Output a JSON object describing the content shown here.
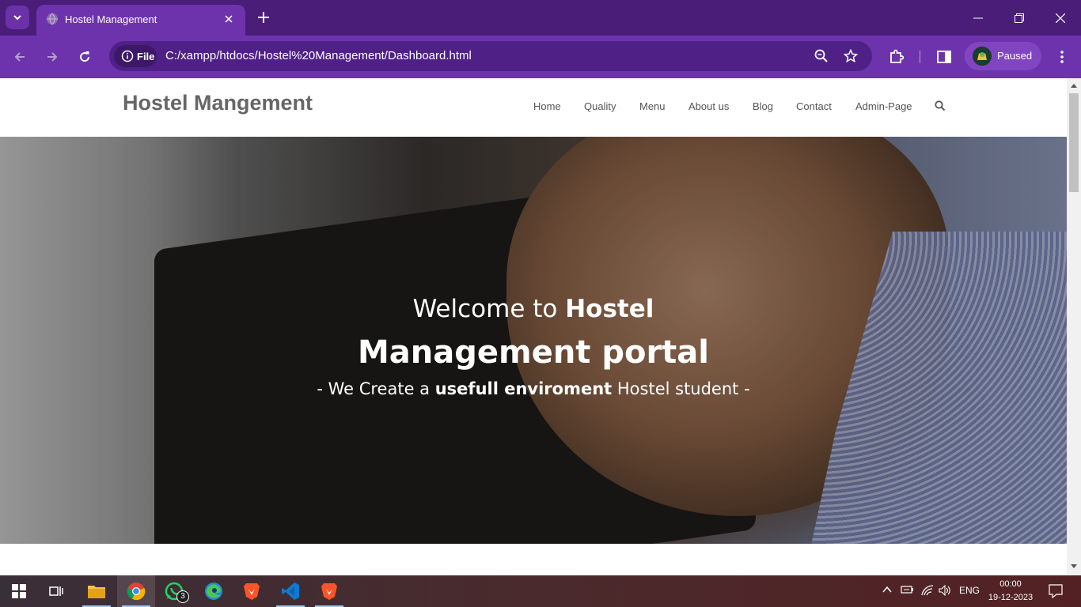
{
  "browser": {
    "tab_title": "Hostel Management",
    "site_info_label": "File",
    "url": "C:/xampp/htdocs/Hostel%20Management/Dashboard.html",
    "profile_label": "Paused"
  },
  "site": {
    "brand": "Hostel Mangement",
    "nav": [
      "Home",
      "Quality",
      "Menu",
      "About us",
      "Blog",
      "Contact",
      "Admin-Page"
    ],
    "hero": {
      "line1_normal": "Welcome to ",
      "line1_bold": "Hostel",
      "line2": "Management portal",
      "line3_pre": "- We Create a ",
      "line3_bold": "usefull enviroment",
      "line3_post": " Hostel student -"
    }
  },
  "taskbar": {
    "whatsapp_badge": "3",
    "language": "ENG",
    "time": "00:00",
    "date": "19-12-2023"
  },
  "colors": {
    "tabbar": "#4a1d79",
    "toolbar": "#6d33ac",
    "omnibox": "#4f2085"
  }
}
